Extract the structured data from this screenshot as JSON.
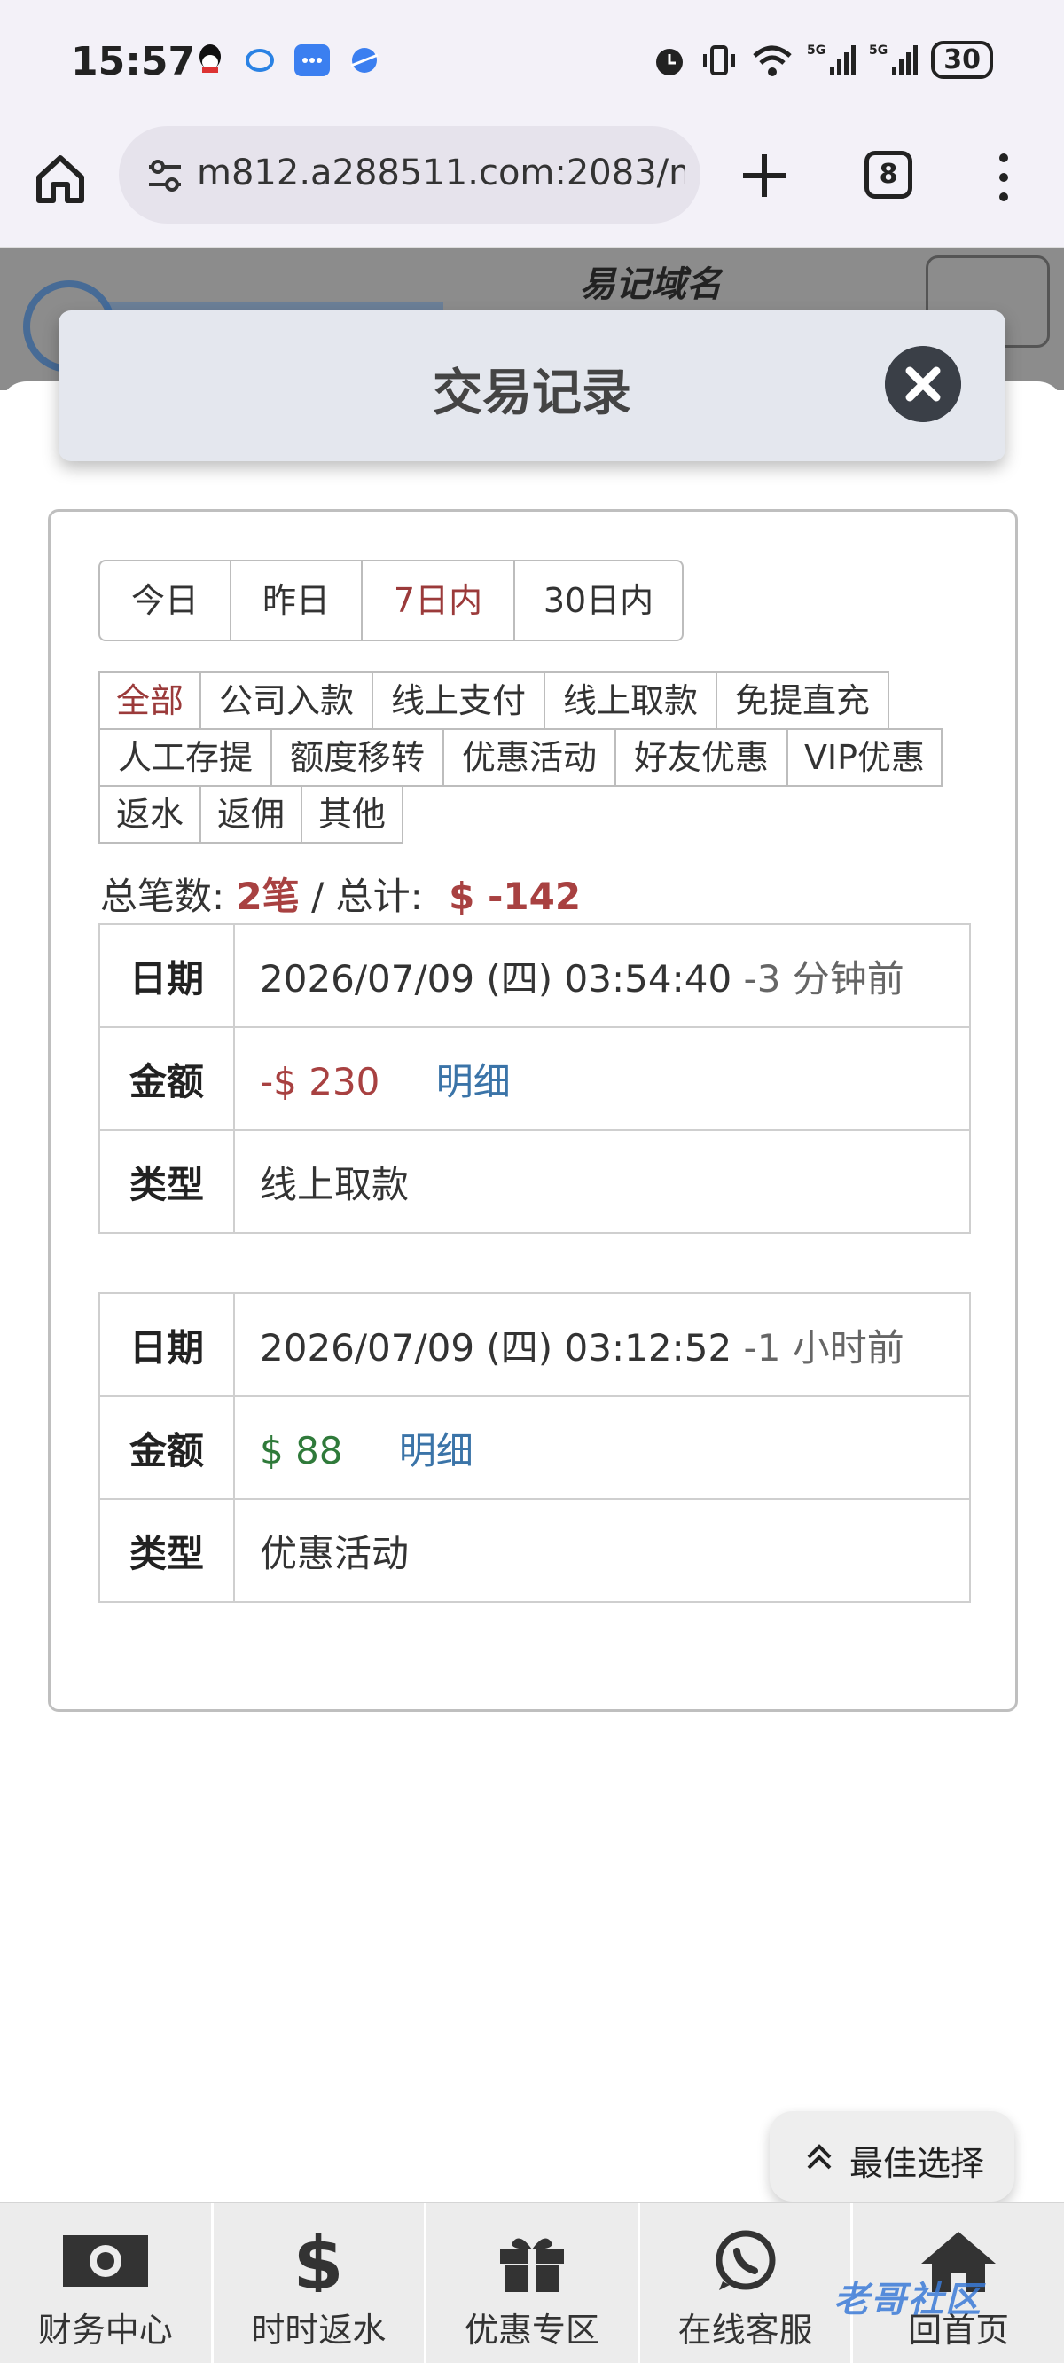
{
  "status_bar": {
    "time": "15:57",
    "battery": "30"
  },
  "browser": {
    "url": "m812.a288511.com:2083/mo",
    "tab_count": "8"
  },
  "background_page": {
    "logo_text": "易记域名"
  },
  "modal": {
    "title": "交易记录",
    "day_filters": [
      {
        "label": "今日",
        "active": false
      },
      {
        "label": "昨日",
        "active": false
      },
      {
        "label": "7日内",
        "active": true
      },
      {
        "label": "30日内",
        "active": false
      }
    ],
    "categories_row1": [
      "全部",
      "公司入款",
      "线上支付",
      "线上取款",
      "免提直充"
    ],
    "categories_row2": [
      "人工存提",
      "额度移转",
      "优惠活动",
      "好友优惠",
      "VIP优惠"
    ],
    "categories_row3": [
      "返水",
      "返佣",
      "其他"
    ],
    "active_category": "全部",
    "summary": {
      "count_label": "总笔数:",
      "count_value": "2笔",
      "separator": " / ",
      "total_label": "总计:",
      "total_value": "$ -142"
    },
    "records": [
      {
        "date_label": "日期",
        "date_value": "2026/07/09 (四) 03:54:40",
        "relative": "-3 分钟前",
        "amount_label": "金额",
        "amount_value": "-$ 230",
        "detail_link": "明细",
        "type_label": "类型",
        "type_value": "线上取款"
      },
      {
        "date_label": "日期",
        "date_value": "2026/07/09 (四) 03:12:52",
        "relative": "-1 小时前",
        "amount_label": "金额",
        "amount_value": "$ 88",
        "detail_link": "明细",
        "type_label": "类型",
        "type_value": "优惠活动"
      }
    ]
  },
  "floating_button": {
    "label": "最佳选择"
  },
  "bottom_nav": [
    {
      "label": "财务中心",
      "icon": "money-icon"
    },
    {
      "label": "时时返水",
      "icon": "dollar-icon"
    },
    {
      "label": "优惠专区",
      "icon": "gift-icon"
    },
    {
      "label": "在线客服",
      "icon": "whatsapp-icon"
    },
    {
      "label": "回首页",
      "icon": "home-icon"
    }
  ],
  "watermark": "老哥社区",
  "colors": {
    "active_red": "#9b3a3a",
    "negative": "#a84141",
    "positive": "#2f7a3a",
    "link": "#3b74a8"
  }
}
